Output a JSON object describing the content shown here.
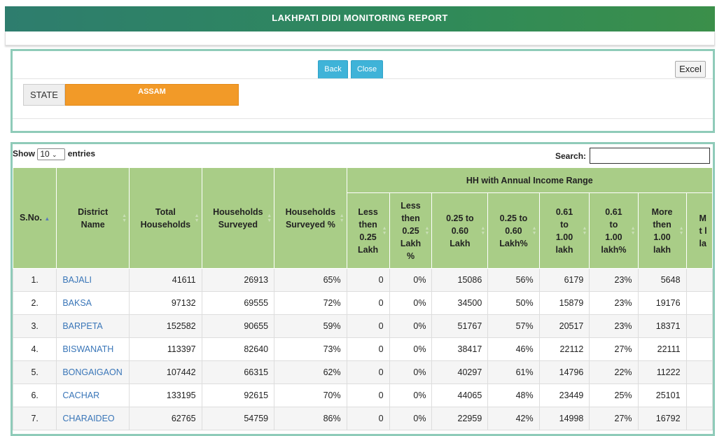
{
  "header": {
    "title": "LAKHPATI DIDI MONITORING REPORT"
  },
  "toolbar": {
    "back_label": "Back",
    "close_label": "Close",
    "excel_label": "Excel"
  },
  "filter": {
    "state_label": "STATE",
    "state_value": "ASSAM"
  },
  "table_controls": {
    "show_label": "Show",
    "entries_value": "10",
    "entries_label": "entries",
    "search_label": "Search:",
    "search_value": ""
  },
  "table": {
    "group_header": "HH with Annual Income Range",
    "columns": {
      "sno": "S.No.",
      "district": "District Name",
      "total": "Total Households",
      "surveyed": "Households Surveyed",
      "surveyed_pct": "Households Surveyed %",
      "lt025": "Less then 0.25 Lakh",
      "lt025_pct": "Less then 0.25 Lakh %",
      "r025_060": "0.25 to 0.60 Lakh",
      "r025_060_pct": "0.25 to 0.60 Lakh%",
      "r061_100": "0.61 to 1.00 lakh",
      "r061_100_pct": "0.61 to 1.00 lakh%",
      "gt100": "More then 1.00 lakh",
      "gt100_pct": "M t l la"
    },
    "rows": [
      {
        "sno": "1.",
        "district": "BAJALI",
        "total": "41611",
        "surveyed": "26913",
        "surveyed_pct": "65%",
        "lt025": "0",
        "lt025_pct": "0%",
        "r025_060": "15086",
        "r025_060_pct": "56%",
        "r061_100": "6179",
        "r061_100_pct": "23%",
        "gt100": "5648"
      },
      {
        "sno": "2.",
        "district": "BAKSA",
        "total": "97132",
        "surveyed": "69555",
        "surveyed_pct": "72%",
        "lt025": "0",
        "lt025_pct": "0%",
        "r025_060": "34500",
        "r025_060_pct": "50%",
        "r061_100": "15879",
        "r061_100_pct": "23%",
        "gt100": "19176"
      },
      {
        "sno": "3.",
        "district": "BARPETA",
        "total": "152582",
        "surveyed": "90655",
        "surveyed_pct": "59%",
        "lt025": "0",
        "lt025_pct": "0%",
        "r025_060": "51767",
        "r025_060_pct": "57%",
        "r061_100": "20517",
        "r061_100_pct": "23%",
        "gt100": "18371"
      },
      {
        "sno": "4.",
        "district": "BISWANATH",
        "total": "113397",
        "surveyed": "82640",
        "surveyed_pct": "73%",
        "lt025": "0",
        "lt025_pct": "0%",
        "r025_060": "38417",
        "r025_060_pct": "46%",
        "r061_100": "22112",
        "r061_100_pct": "27%",
        "gt100": "22111"
      },
      {
        "sno": "5.",
        "district": "BONGAIGAON",
        "total": "107442",
        "surveyed": "66315",
        "surveyed_pct": "62%",
        "lt025": "0",
        "lt025_pct": "0%",
        "r025_060": "40297",
        "r025_060_pct": "61%",
        "r061_100": "14796",
        "r061_100_pct": "22%",
        "gt100": "11222"
      },
      {
        "sno": "6.",
        "district": "CACHAR",
        "total": "133195",
        "surveyed": "92615",
        "surveyed_pct": "70%",
        "lt025": "0",
        "lt025_pct": "0%",
        "r025_060": "44065",
        "r025_060_pct": "48%",
        "r061_100": "23449",
        "r061_100_pct": "25%",
        "gt100": "25101"
      },
      {
        "sno": "7.",
        "district": "CHARAIDEO",
        "total": "62765",
        "surveyed": "54759",
        "surveyed_pct": "86%",
        "lt025": "0",
        "lt025_pct": "0%",
        "r025_060": "22959",
        "r025_060_pct": "42%",
        "r061_100": "14998",
        "r061_100_pct": "27%",
        "gt100": "16792"
      }
    ]
  }
}
